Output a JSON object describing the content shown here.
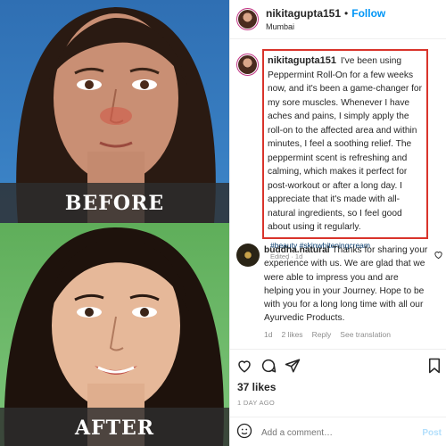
{
  "image": {
    "before_label": "BEFORE",
    "after_label": "AFTER"
  },
  "post": {
    "header": {
      "username": "nikitagupta151",
      "separator": "•",
      "follow_label": "Follow",
      "location": "Mumbai"
    },
    "caption": {
      "username": "nikitagupta151",
      "text": "I've been using Peppermint Roll-On for a few weeks now, and it's been a game-changer for my sore muscles. Whenever I have aches and pains, I simply apply the roll-on to the affected area and within minutes, I feel a soothing relief. The peppermint scent is refreshing and calming, which makes it perfect for post-workout or after a long day. I appreciate that it's made with all-natural ingredients, so I feel good about using it regularly.",
      "hashtags": "#beauty #skinwhiteningcream",
      "edited": "Edited · 1d"
    },
    "comment": {
      "username": "buddha.natural",
      "text": "Thanks for sharing your experience with us. We are glad that we were able to impress you and are helping you in your Journey. Hope to be with you for a long long time with all our Ayurvedic Products.",
      "age": "1d",
      "likes": "2 likes",
      "reply": "Reply",
      "see_translation": "See translation"
    },
    "likes": "37 likes",
    "timestamp": "1 DAY AGO",
    "add_comment": {
      "placeholder": "Add a comment…",
      "post_label": "Post"
    },
    "icons": [
      "heart-icon",
      "comment-icon",
      "share-icon",
      "bookmark-icon",
      "emoji-icon",
      "comment-like-icon"
    ],
    "colors": {
      "follow": "#0095f6",
      "highlight_box": "#d9342b",
      "hashtag": "#00376b",
      "muted": "#8e8e8e"
    }
  }
}
